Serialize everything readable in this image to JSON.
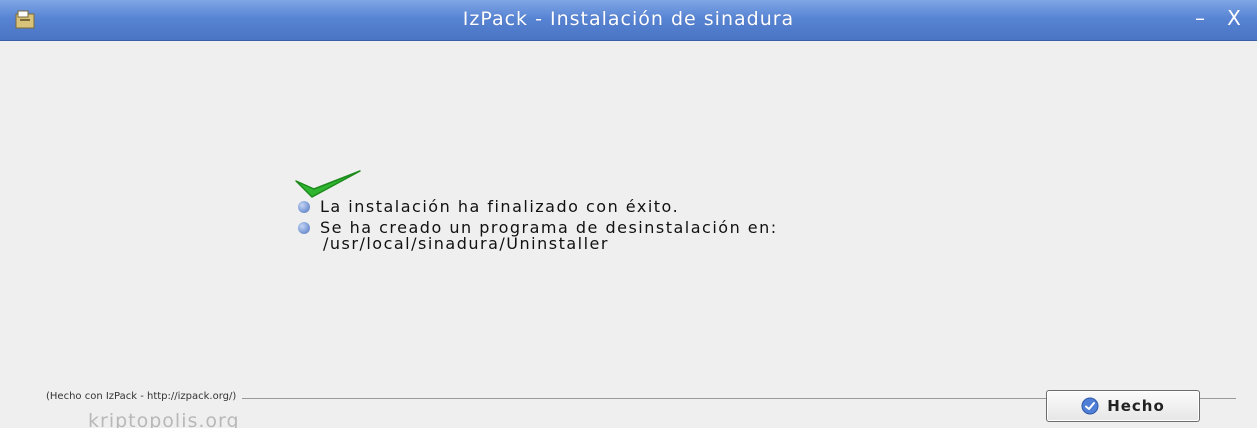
{
  "window": {
    "title": "IzPack - Instalación de sinadura",
    "minimize_glyph": "–",
    "close_glyph": "X"
  },
  "content": {
    "success_icon": "checkmark-icon",
    "messages": [
      "La instalación ha finalizado con éxito.",
      "Se ha creado un programa de desinstalación en:",
      "/usr/local/sinadura/Uninstaller"
    ],
    "bullet_icon": "bullet-icon"
  },
  "footer": {
    "made_with_label": "(Hecho con IzPack - http://izpack.org/)"
  },
  "buttons": {
    "done_label": "Hecho",
    "done_icon": "check-circle-icon"
  },
  "watermark": {
    "text": "kriptopolis.org"
  },
  "colors": {
    "titlebar": "#5884d4",
    "background": "#efefef",
    "check_green": "#2fb52f"
  }
}
